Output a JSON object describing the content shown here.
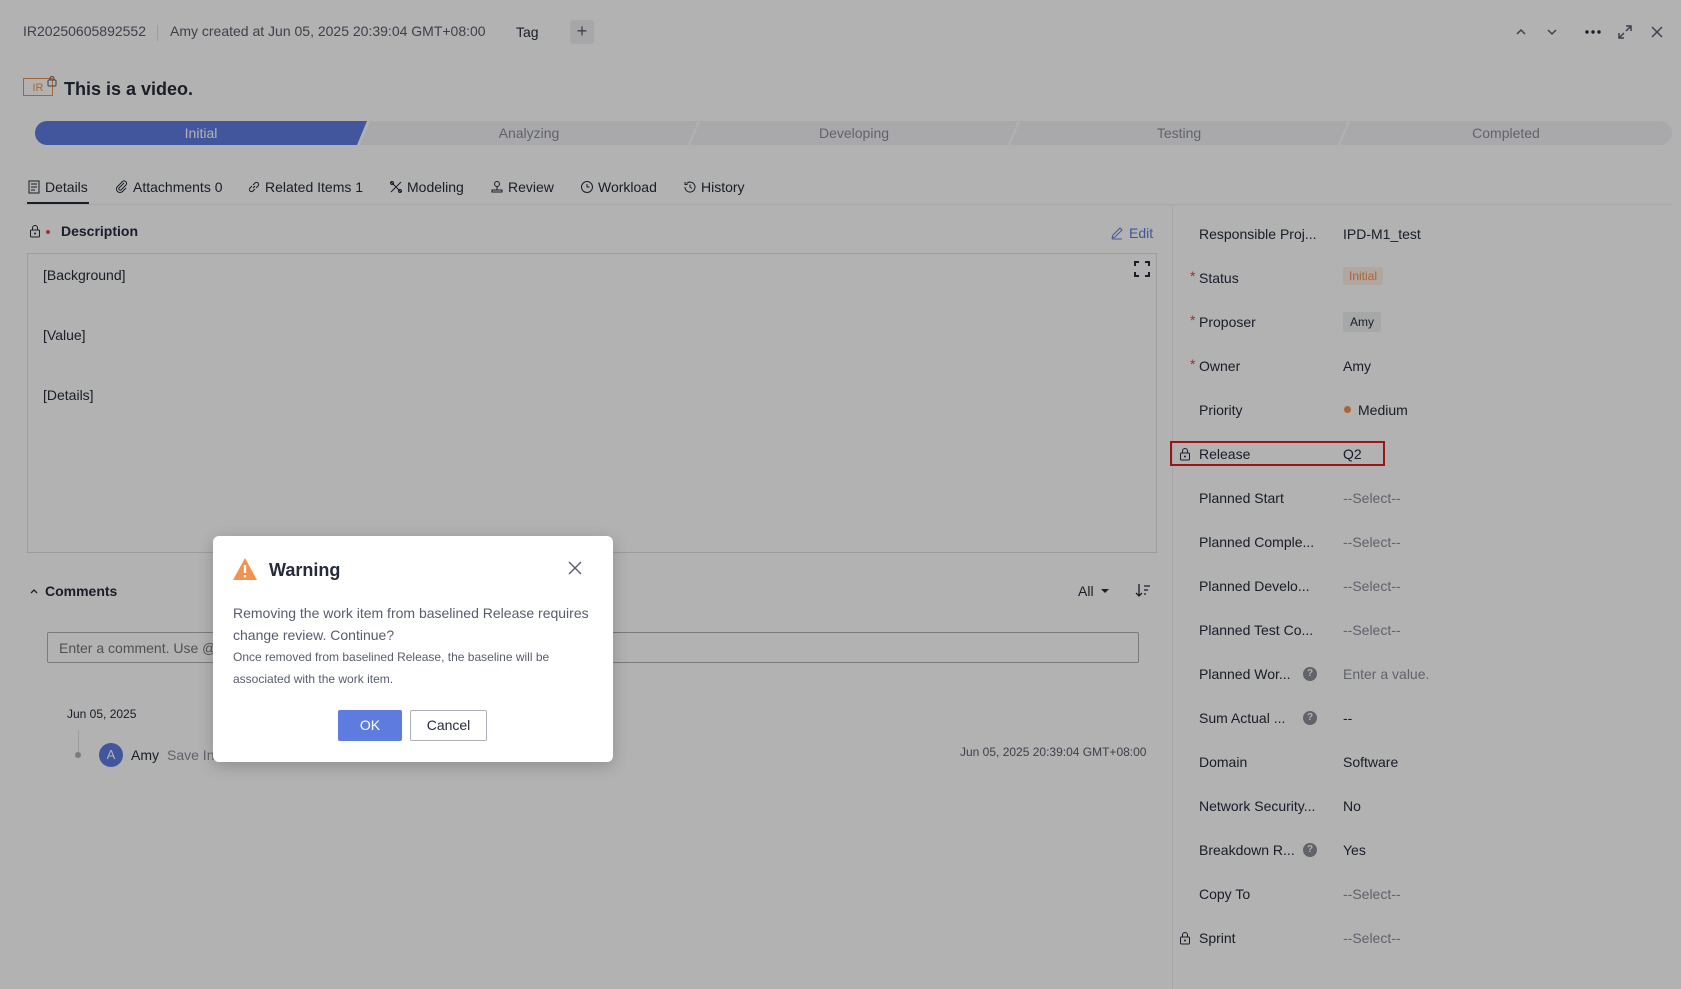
{
  "header": {
    "id": "IR20250605892552",
    "created": "Amy created at Jun 05, 2025 20:39:04 GMT+08:00",
    "tag_label": "Tag",
    "add_label": "+"
  },
  "item": {
    "type_badge": "IR",
    "title": "This is a video."
  },
  "stages": [
    {
      "label": "Initial",
      "active": true
    },
    {
      "label": "Analyzing"
    },
    {
      "label": "Developing"
    },
    {
      "label": "Testing"
    },
    {
      "label": "Completed"
    }
  ],
  "tabs": [
    {
      "label": "Details",
      "icon": "document-icon"
    },
    {
      "label": "Attachments 0",
      "icon": "paperclip-icon"
    },
    {
      "label": "Related Items 1",
      "icon": "link-icon"
    },
    {
      "label": "Modeling",
      "icon": "modeling-icon"
    },
    {
      "label": "Review",
      "icon": "review-icon"
    },
    {
      "label": "Workload",
      "icon": "clock-icon"
    },
    {
      "label": "History",
      "icon": "history-icon"
    }
  ],
  "description": {
    "title": "Description",
    "edit_label": "Edit",
    "lines": [
      "[Background]",
      "[Value]",
      "[Details]"
    ]
  },
  "comments": {
    "title": "Comments",
    "filter": "All",
    "placeholder": "Enter a comment. Use @",
    "entries": [
      {
        "date": "Jun 05, 2025",
        "avatar": "A",
        "user": "Amy",
        "text": "Save In",
        "time": "Jun 05, 2025 20:39:04 GMT+08:00"
      }
    ]
  },
  "fields": [
    {
      "label": "Responsible Proj...",
      "value": "IPD-M1_test"
    },
    {
      "label": "Status",
      "value": "Initial",
      "required": true
    },
    {
      "label": "Proposer",
      "value": "Amy",
      "required": true
    },
    {
      "label": "Owner",
      "value": "Amy",
      "required": true
    },
    {
      "label": "Priority",
      "value": "Medium"
    },
    {
      "label": "Release",
      "value": "Q2",
      "locked": true
    },
    {
      "label": "Planned Start",
      "value": "--Select--"
    },
    {
      "label": "Planned Comple...",
      "value": "--Select--"
    },
    {
      "label": "Planned Develo...",
      "value": "--Select--"
    },
    {
      "label": "Planned Test Co...",
      "value": "--Select--"
    },
    {
      "label": "Planned Wor...",
      "value": "Enter a value.",
      "help": true
    },
    {
      "label": "Sum Actual ...",
      "value": "--",
      "help": true
    },
    {
      "label": "Domain",
      "value": "Software"
    },
    {
      "label": "Network Security...",
      "value": "No"
    },
    {
      "label": "Breakdown R...",
      "value": "Yes",
      "help": true
    },
    {
      "label": "Copy To",
      "value": "--Select--"
    },
    {
      "label": "Sprint",
      "value": "--Select--",
      "locked": true
    }
  ],
  "modal": {
    "title": "Warning",
    "message": "Removing the work item from baselined Release requires change review. Continue?",
    "sub_message": "Once removed from baselined Release, the baseline will be associated with the work item.",
    "ok_label": "OK",
    "cancel_label": "Cancel"
  },
  "colors": {
    "accent": "#5e7ce0",
    "warning": "#f2924d",
    "required": "#e54545",
    "highlight": "#e21c1c"
  }
}
